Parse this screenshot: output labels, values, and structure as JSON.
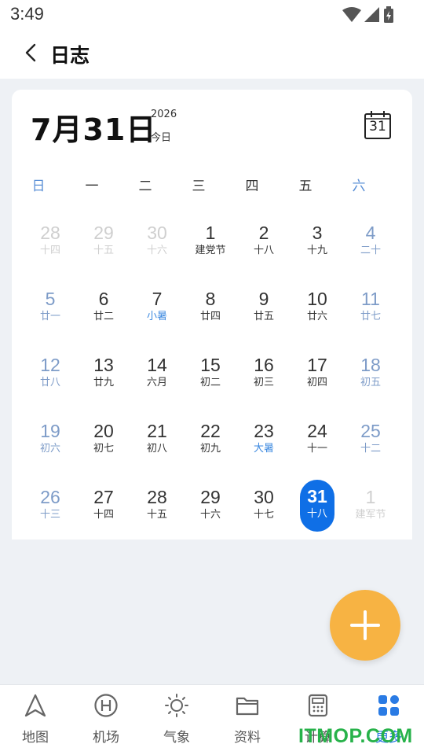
{
  "status_bar": {
    "time": "3:49"
  },
  "header": {
    "title": "日志",
    "back_icon": "chevron-left-icon"
  },
  "card": {
    "big_date": "7月31日",
    "year": "2026",
    "today": "今日",
    "calendar_button_number": "31"
  },
  "calendar": {
    "weekdays": [
      "日",
      "一",
      "二",
      "三",
      "四",
      "五",
      "六"
    ],
    "weeks": [
      [
        {
          "day": "28",
          "sub": "十四",
          "state": "faded"
        },
        {
          "day": "29",
          "sub": "十五",
          "state": "faded"
        },
        {
          "day": "30",
          "sub": "十六",
          "state": "faded"
        },
        {
          "day": "1",
          "sub": "建党节",
          "state": "normal"
        },
        {
          "day": "2",
          "sub": "十八",
          "state": "normal"
        },
        {
          "day": "3",
          "sub": "十九",
          "state": "normal"
        },
        {
          "day": "4",
          "sub": "二十",
          "state": "weekend"
        }
      ],
      [
        {
          "day": "5",
          "sub": "廿一",
          "state": "weekend"
        },
        {
          "day": "6",
          "sub": "廿二",
          "state": "normal"
        },
        {
          "day": "7",
          "sub": "小暑",
          "state": "term"
        },
        {
          "day": "8",
          "sub": "廿四",
          "state": "normal"
        },
        {
          "day": "9",
          "sub": "廿五",
          "state": "normal"
        },
        {
          "day": "10",
          "sub": "廿六",
          "state": "normal"
        },
        {
          "day": "11",
          "sub": "廿七",
          "state": "weekend"
        }
      ],
      [
        {
          "day": "12",
          "sub": "廿八",
          "state": "weekend"
        },
        {
          "day": "13",
          "sub": "廿九",
          "state": "normal"
        },
        {
          "day": "14",
          "sub": "六月",
          "state": "normal"
        },
        {
          "day": "15",
          "sub": "初二",
          "state": "normal"
        },
        {
          "day": "16",
          "sub": "初三",
          "state": "normal"
        },
        {
          "day": "17",
          "sub": "初四",
          "state": "normal"
        },
        {
          "day": "18",
          "sub": "初五",
          "state": "weekend"
        }
      ],
      [
        {
          "day": "19",
          "sub": "初六",
          "state": "weekend"
        },
        {
          "day": "20",
          "sub": "初七",
          "state": "normal"
        },
        {
          "day": "21",
          "sub": "初八",
          "state": "normal"
        },
        {
          "day": "22",
          "sub": "初九",
          "state": "normal"
        },
        {
          "day": "23",
          "sub": "大暑",
          "state": "term"
        },
        {
          "day": "24",
          "sub": "十一",
          "state": "normal"
        },
        {
          "day": "25",
          "sub": "十二",
          "state": "weekend"
        }
      ],
      [
        {
          "day": "26",
          "sub": "十三",
          "state": "weekend"
        },
        {
          "day": "27",
          "sub": "十四",
          "state": "normal"
        },
        {
          "day": "28",
          "sub": "十五",
          "state": "normal"
        },
        {
          "day": "29",
          "sub": "十六",
          "state": "normal"
        },
        {
          "day": "30",
          "sub": "十七",
          "state": "normal"
        },
        {
          "day": "31",
          "sub": "十八",
          "state": "selected"
        },
        {
          "day": "1",
          "sub": "建军节",
          "state": "faded"
        }
      ]
    ]
  },
  "fab": {
    "icon": "plus-icon"
  },
  "bottom_nav": {
    "items": [
      {
        "label": "地图",
        "icon": "navigation-arrow-icon"
      },
      {
        "label": "机场",
        "icon": "heliport-icon"
      },
      {
        "label": "气象",
        "icon": "sun-icon"
      },
      {
        "label": "资料",
        "icon": "folder-icon"
      },
      {
        "label": "计算",
        "icon": "calculator-icon"
      },
      {
        "label": "更多",
        "icon": "grid-icon"
      }
    ],
    "active_index": 5
  },
  "watermark": "ITMOP.COM",
  "colors": {
    "accent": "#0f6fe6",
    "fab": "#f7b343",
    "weekend": "#7e9cc8",
    "solar_term": "#3d8ae0",
    "watermark": "#27b24a"
  }
}
